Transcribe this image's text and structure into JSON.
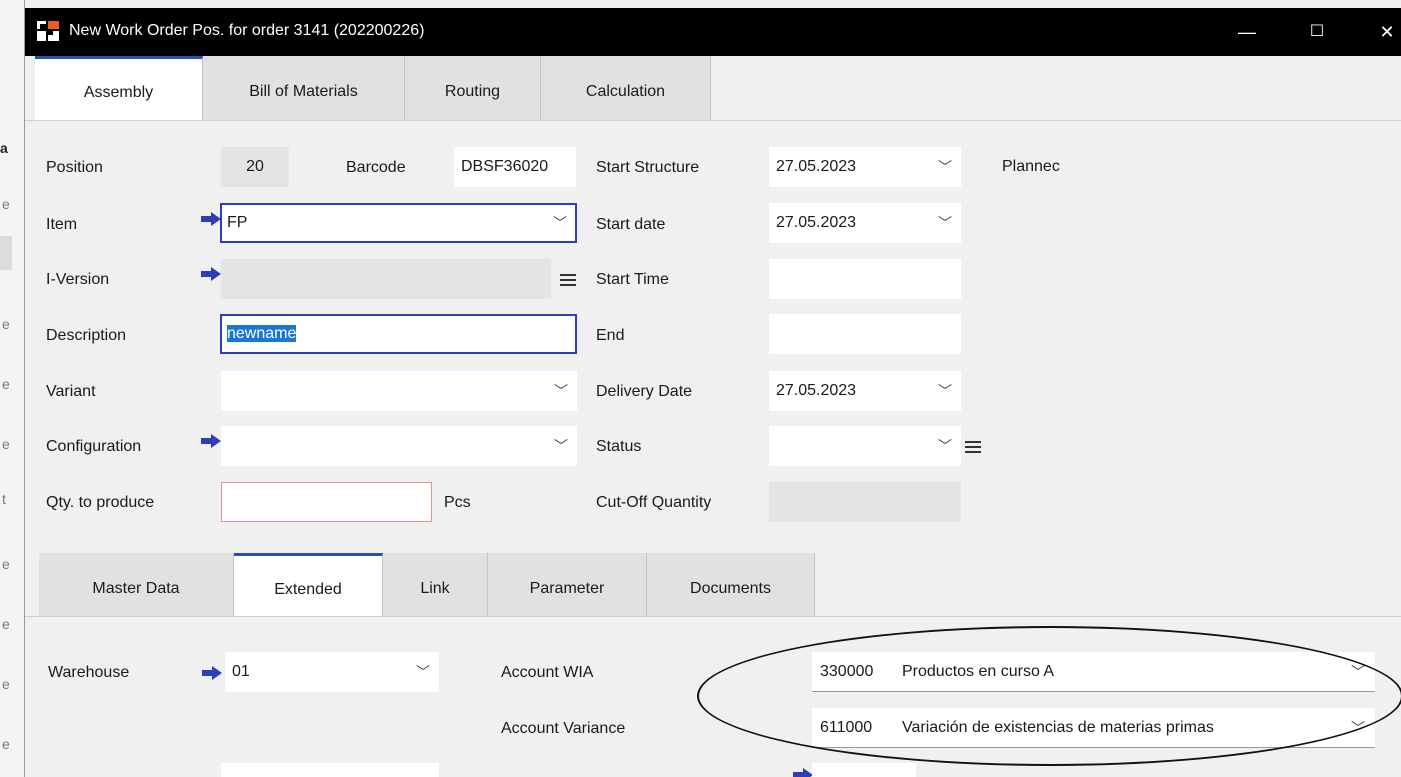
{
  "background": {
    "fragments": [
      "a",
      "e",
      "e",
      "e",
      "e",
      "e",
      "t",
      "e",
      "e",
      "e",
      "e"
    ]
  },
  "window": {
    "title": "New Work Order Pos. for order 3141 (202200226)",
    "minimize_symbol": "—",
    "maximize_symbol": "☐",
    "close_symbol": "✕"
  },
  "tabs": [
    "Assembly",
    "Bill of Materials",
    "Routing",
    "Calculation"
  ],
  "form": {
    "position": {
      "label": "Position",
      "value": "20"
    },
    "barcode": {
      "label": "Barcode",
      "value": "DBSF36020"
    },
    "item": {
      "label": "Item",
      "value": "FP"
    },
    "iversion": {
      "label": "I-Version",
      "value": ""
    },
    "description": {
      "label": "Description",
      "value": "newname"
    },
    "variant": {
      "label": "Variant",
      "value": ""
    },
    "configuration": {
      "label": "Configuration",
      "value": ""
    },
    "qty": {
      "label": "Qty. to produce",
      "value": "",
      "unit": "Pcs"
    },
    "start_structure": {
      "label": "Start Structure",
      "value": "27.05.2023"
    },
    "planned": {
      "label": "Plannec"
    },
    "start_date": {
      "label": "Start date",
      "value": "27.05.2023"
    },
    "start_time": {
      "label": "Start Time",
      "value": ""
    },
    "end": {
      "label": "End",
      "value": ""
    },
    "delivery_date": {
      "label": "Delivery Date",
      "value": "27.05.2023"
    },
    "status": {
      "label": "Status",
      "value": ""
    },
    "cutoff": {
      "label": "Cut-Off Quantity",
      "value": ""
    }
  },
  "subtabs": [
    "Master Data",
    "Extended",
    "Link",
    "Parameter",
    "Documents"
  ],
  "extended": {
    "warehouse": {
      "label": "Warehouse",
      "value": "01"
    },
    "account_wia": {
      "label": "Account WIA",
      "code": "330000",
      "name": "Productos en curso A"
    },
    "account_variance": {
      "label": "Account Variance",
      "code": "611000",
      "name": "Variación de existencias de materias primas"
    }
  },
  "colors": {
    "titlebar": "#000000",
    "focus_border": "#2e3db8",
    "arrow": "#2e3db8",
    "selection": "#1a78d4",
    "required_border": "#e8908c"
  },
  "icons": [
    "app-logo-icon",
    "arrow-right-icon",
    "chevron-down-icon",
    "menu-lines-icon",
    "minimize-icon",
    "maximize-icon",
    "close-icon"
  ]
}
